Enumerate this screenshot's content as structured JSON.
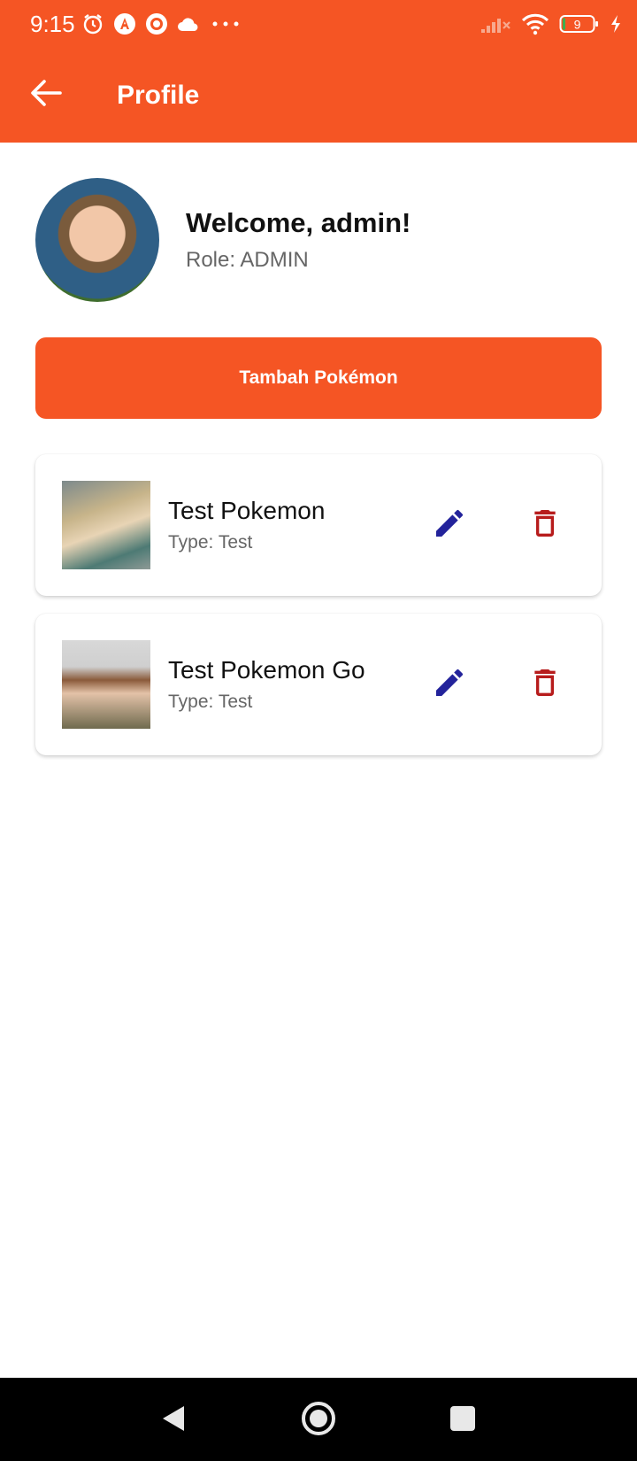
{
  "status_bar": {
    "time": "9:15",
    "battery": "9",
    "icons_left": [
      "alarm-icon",
      "angular-app-icon",
      "radar-app-icon",
      "cloud-icon",
      "more-dots-icon"
    ],
    "icons_right": [
      "signal-off-icon",
      "wifi-icon",
      "battery-icon",
      "charging-icon"
    ]
  },
  "app_bar": {
    "title": "Profile",
    "back_icon": "arrow-left-icon",
    "color": "#F55524"
  },
  "profile": {
    "welcome": "Welcome, admin!",
    "role": "Role: ADMIN"
  },
  "add_button": {
    "label": "Tambah Pokémon",
    "color": "#F55524"
  },
  "pokemon_list": [
    {
      "name": "Test Pokemon",
      "type": "Type: Test"
    },
    {
      "name": "Test Pokemon Go",
      "type": "Type: Test"
    }
  ],
  "colors": {
    "edit_icon": "#23239B",
    "delete_icon": "#B71C1C"
  },
  "nav_bar": {
    "icons": [
      "back-triangle-icon",
      "home-circle-icon",
      "recents-square-icon"
    ]
  }
}
